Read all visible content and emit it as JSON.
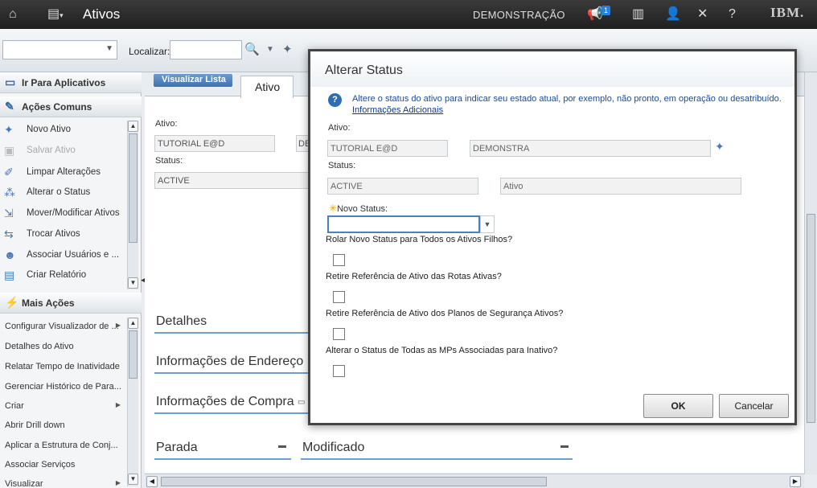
{
  "topbar": {
    "title": "Ativos",
    "org": "DEMONSTRAÇÃO",
    "notification_count": "1",
    "brand": "IBM."
  },
  "toolbar": {
    "search_label": "Localizar:",
    "search_value": "",
    "select_value": ""
  },
  "sidebar": {
    "go_to_apps": "Ir Para Aplicativos",
    "common_actions_title": "Ações Comuns",
    "common_actions": [
      {
        "label": "Novo Ativo",
        "enabled": true
      },
      {
        "label": "Salvar Ativo",
        "enabled": false
      },
      {
        "label": "Limpar Alterações",
        "enabled": true
      },
      {
        "label": "Alterar o Status",
        "enabled": true
      },
      {
        "label": "Mover/Modificar Ativos",
        "enabled": true
      },
      {
        "label": "Trocar Ativos",
        "enabled": true
      },
      {
        "label": "Associar Usuários e ...",
        "enabled": true
      },
      {
        "label": "Criar Relatório",
        "enabled": true
      }
    ],
    "more_actions_title": "Mais Ações",
    "more_actions": [
      {
        "label": "Configurar Visualizador de ..."
      },
      {
        "label": "Detalhes do Ativo"
      },
      {
        "label": "Relatar Tempo de Inatividade"
      },
      {
        "label": "Gerenciar Histórico de Para..."
      },
      {
        "label": "Criar"
      },
      {
        "label": "Abrir Drill down"
      },
      {
        "label": "Aplicar a Estrutura de Conj..."
      },
      {
        "label": "Associar Serviços"
      },
      {
        "label": "Visualizar"
      }
    ]
  },
  "main": {
    "list_button": "Visualizar Lista",
    "active_tab": "Ativo",
    "asset_label": "Ativo:",
    "asset_value": "TUTORIAL E@D",
    "asset_desc_partial": "DE",
    "status_label": "Status:",
    "status_value": "ACTIVE",
    "sections": {
      "details": "Detalhes",
      "address": "Informações de Endereço",
      "purchase": "Informações de Compra",
      "downtime": "Parada",
      "modified": "Modificado"
    }
  },
  "dialog": {
    "title": "Alterar Status",
    "description": "Altere o status do ativo para indicar seu estado atual, por exemplo, não pronto, em operação ou desatribuído.",
    "more_info_link": "Informações Adicionais",
    "asset_label": "Ativo:",
    "asset_value": "TUTORIAL E@D",
    "asset_desc": "DEMONSTRA",
    "status_label": "Status:",
    "status_value": "ACTIVE",
    "status_desc": "Ativo",
    "new_status_label": "Novo Status:",
    "new_status_value": "",
    "questions": [
      {
        "label": "Rolar Novo Status para Todos os Ativos Filhos?",
        "checked": false
      },
      {
        "label": "Retire Referência de Ativo das Rotas Ativas?",
        "checked": false
      },
      {
        "label": "Retire Referência de Ativo dos Planos de Segurança Ativos?",
        "checked": false
      },
      {
        "label": "Alterar o Status de Todas as MPs Associadas para Inativo?",
        "checked": false
      }
    ],
    "ok_label": "OK",
    "cancel_label": "Cancelar"
  }
}
